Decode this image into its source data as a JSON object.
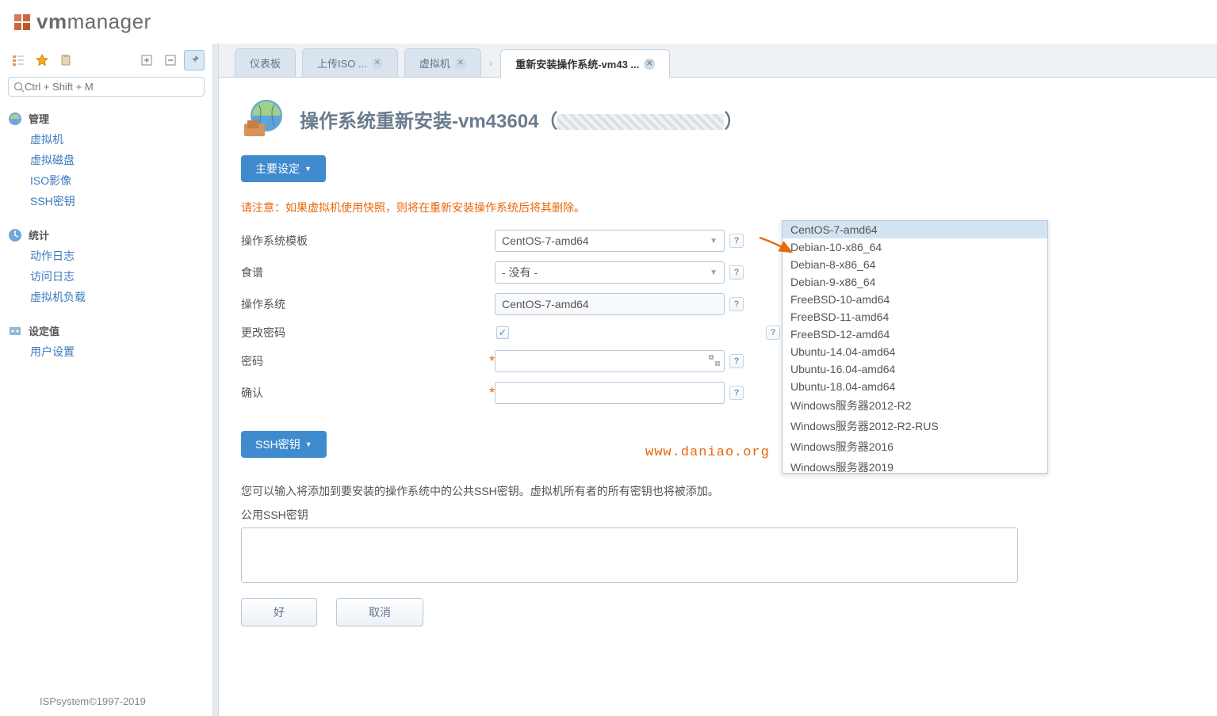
{
  "logo": {
    "bold": "vm",
    "light": "manager"
  },
  "search": {
    "placeholder": "Ctrl + Shift + M"
  },
  "sidebar": {
    "sections": [
      {
        "title": "管理",
        "items": [
          "虚拟机",
          "虚拟磁盘",
          "ISO影像",
          "SSH密钥"
        ]
      },
      {
        "title": "统计",
        "items": [
          "动作日志",
          "访问日志",
          "虚拟机负载"
        ]
      },
      {
        "title": "设定值",
        "items": [
          "用户设置"
        ]
      }
    ]
  },
  "footer": "ISPsystem©1997-2019",
  "tabs": [
    {
      "label": "仪表板",
      "closable": false
    },
    {
      "label": "上传ISO ...",
      "closable": true
    },
    {
      "label": "虚拟机",
      "closable": true
    },
    {
      "label": "重新安装操作系统-vm43 ...",
      "closable": true,
      "active": true
    }
  ],
  "page": {
    "title": "操作系统重新安装-vm43604（",
    "title_end": "）"
  },
  "sections": {
    "main_label": "主要设定",
    "ssh_label": "SSH密钥"
  },
  "warning": "请注意：如果虚拟机使用快照，则将在重新安装操作系统后将其删除。",
  "form": {
    "os_template": {
      "label": "操作系统模板",
      "value": "CentOS-7-amd64"
    },
    "recipe": {
      "label": "食谱",
      "value": "- 没有 -"
    },
    "os": {
      "label": "操作系统",
      "value": "CentOS-7-amd64"
    },
    "change_pw": {
      "label": "更改密码",
      "checked": true
    },
    "password": {
      "label": "密码",
      "value": ""
    },
    "confirm": {
      "label": "确认",
      "value": ""
    }
  },
  "ssh": {
    "note": "您可以输入将添加到要安装的操作系统中的公共SSH密钥。虚拟机所有者的所有密钥也将被添加。",
    "label": "公用SSH密钥"
  },
  "buttons": {
    "ok": "好",
    "cancel": "取消"
  },
  "dropdown": {
    "options": [
      "CentOS-7-amd64",
      "Debian-10-x86_64",
      "Debian-8-x86_64",
      "Debian-9-x86_64",
      "FreeBSD-10-amd64",
      "FreeBSD-11-amd64",
      "FreeBSD-12-amd64",
      "Ubuntu-14.04-amd64",
      "Ubuntu-16.04-amd64",
      "Ubuntu-18.04-amd64",
      "Windows服务器2012-R2",
      "Windows服务器2012-R2-RUS",
      "Windows服务器2016",
      "Windows服务器2019"
    ],
    "selected": 0
  },
  "watermark": "www.daniao.org"
}
